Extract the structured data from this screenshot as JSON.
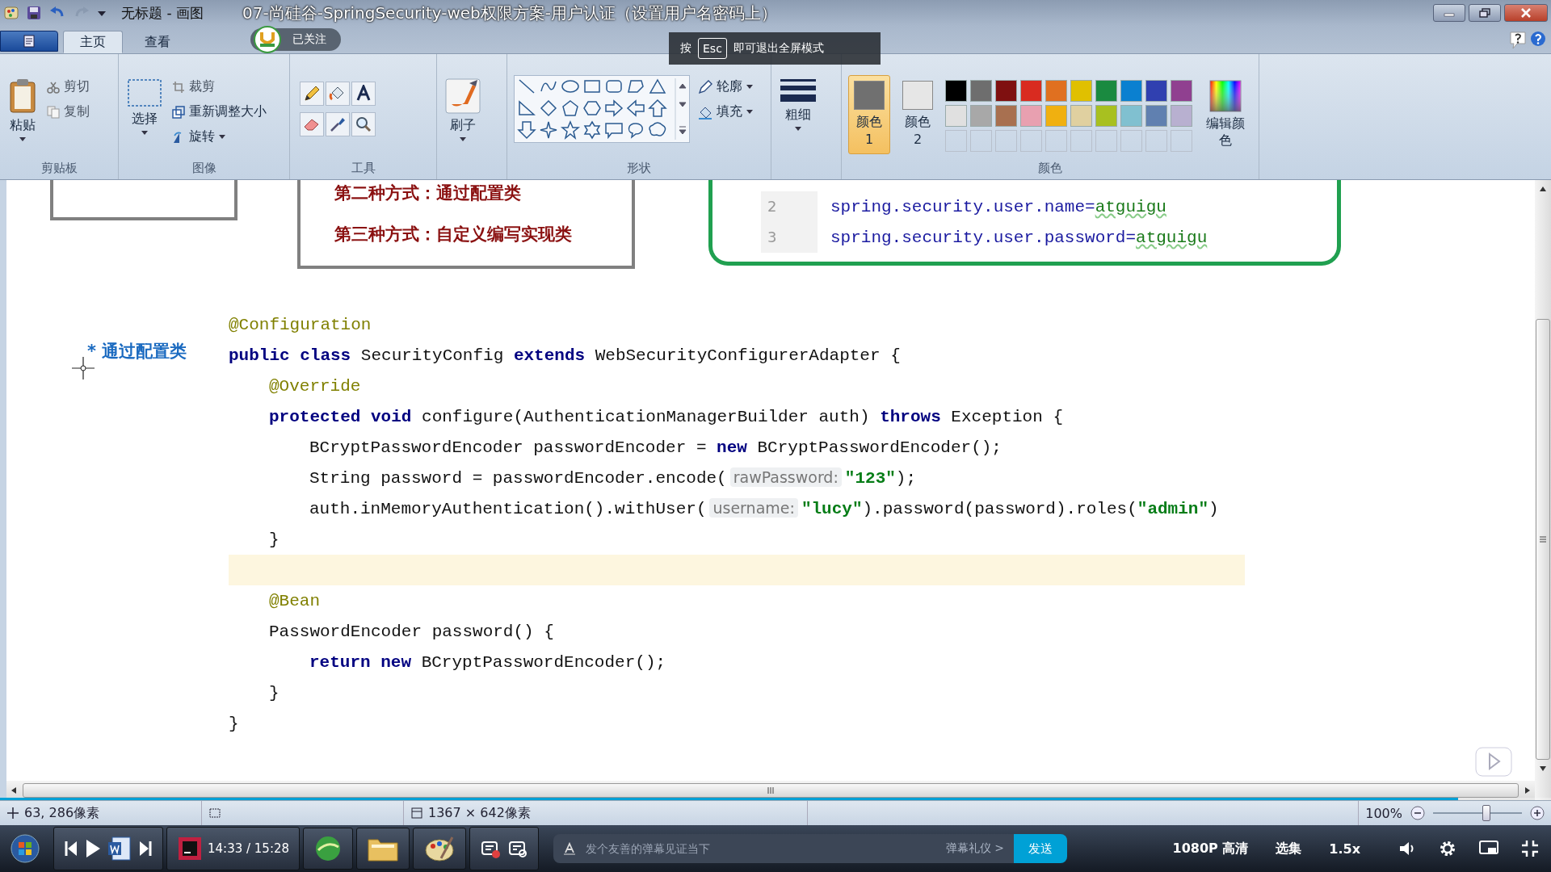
{
  "paint_window": {
    "title": "无标题 - 画图",
    "ribbon_tabs": [
      {
        "label": "主页",
        "selected": true
      },
      {
        "label": "查看",
        "selected": false
      }
    ],
    "clipboard": {
      "paste": "粘贴",
      "cut": "剪切",
      "copy": "复制",
      "group": "剪贴板"
    },
    "image": {
      "select": "选择",
      "crop": "裁剪",
      "resize": "重新调整大小",
      "rotate": "旋转",
      "group": "图像"
    },
    "tools": {
      "group": "工具"
    },
    "brushes": {
      "label": "刷子"
    },
    "shapes": {
      "outline": "轮廓",
      "fill": "填充",
      "group": "形状"
    },
    "size": {
      "label": "粗细"
    },
    "colors": {
      "color1": {
        "label": "颜色 1",
        "selected": true
      },
      "color2": {
        "label": "颜色 2",
        "selected": false
      },
      "palette": [
        {
          "color": "#000000"
        },
        {
          "color": "#6e6e6e"
        },
        {
          "color": "#7f1010"
        },
        {
          "color": "#d92b20"
        },
        {
          "color": "#e07020"
        },
        {
          "color": "#e0c000"
        },
        {
          "color": "#1a8a40"
        },
        {
          "color": "#0a80d0"
        },
        {
          "color": "#3040b0"
        },
        {
          "color": "#904090"
        },
        {
          "color": "#e0e0e0"
        },
        {
          "color": "#a8a8a8"
        },
        {
          "color": "#a87050"
        },
        {
          "color": "#e8a0b0"
        },
        {
          "color": "#f0b010"
        },
        {
          "color": "#e0d0a0"
        },
        {
          "color": "#a8c020"
        },
        {
          "color": "#80c0d0"
        },
        {
          "color": "#6080b0"
        },
        {
          "color": "#b8b0d0"
        }
      ],
      "edit": "编辑颜色",
      "group": "颜色"
    }
  },
  "canvas": {
    "method_lines": [
      "第二种方式：通过配置类",
      "第三种方式：自定义编写实现类"
    ],
    "properties": [
      {
        "number": "2",
        "key": "spring.security.user.name=",
        "value": "atguigu"
      },
      {
        "number": "3",
        "key": "spring.security.user.password=",
        "value": "atguigu"
      }
    ],
    "annotation": "* 通过配置类",
    "code": [
      {
        "highlighted": false,
        "tokens": [
          {
            "kind": "ann",
            "text": "@Configuration"
          }
        ]
      },
      {
        "highlighted": false,
        "tokens": [
          {
            "kind": "kw",
            "text": "public class"
          },
          {
            "kind": "plain",
            "text": " SecurityConfig "
          },
          {
            "kind": "kw",
            "text": "extends"
          },
          {
            "kind": "plain",
            "text": " WebSecurityConfigurerAdapter {"
          }
        ],
        "children": [
          {
            "highlighted": false,
            "tokens": [
              {
                "kind": "ann",
                "text": "@Override"
              }
            ]
          },
          {
            "highlighted": false,
            "tokens": [
              {
                "kind": "kw",
                "text": "protected void"
              },
              {
                "kind": "plain",
                "text": " configure(AuthenticationManagerBuilder auth) "
              },
              {
                "kind": "kw",
                "text": "throws"
              },
              {
                "kind": "plain",
                "text": " Exception {"
              }
            ],
            "children": [
              {
                "highlighted": false,
                "tokens": [
                  {
                    "kind": "plain",
                    "text": "BCryptPasswordEncoder passwordEncoder = "
                  },
                  {
                    "kind": "kw",
                    "text": "new"
                  },
                  {
                    "kind": "plain",
                    "text": " BCryptPasswordEncoder();"
                  }
                ]
              },
              {
                "highlighted": false,
                "tokens": [
                  {
                    "kind": "plain",
                    "text": "String password = passwordEncoder.encode("
                  },
                  {
                    "kind": "hint",
                    "text": "rawPassword:"
                  },
                  {
                    "kind": "str",
                    "text": "\"123\""
                  },
                  {
                    "kind": "plain",
                    "text": ");"
                  }
                ]
              },
              {
                "highlighted": false,
                "tokens": [
                  {
                    "kind": "plain",
                    "text": "auth.inMemoryAuthentication().withUser("
                  },
                  {
                    "kind": "hint",
                    "text": "username:"
                  },
                  {
                    "kind": "str",
                    "text": "\"lucy\""
                  },
                  {
                    "kind": "plain",
                    "text": ").password(password).roles("
                  },
                  {
                    "kind": "str",
                    "text": "\"admin\""
                  },
                  {
                    "kind": "plain",
                    "text": ")"
                  }
                ]
              }
            ]
          },
          {
            "highlighted": false,
            "tokens": [
              {
                "kind": "plain",
                "text": "}"
              }
            ]
          },
          {
            "highlighted": true
          },
          {
            "highlighted": false,
            "tokens": [
              {
                "kind": "ann",
                "text": "@Bean"
              }
            ]
          },
          {
            "highlighted": false,
            "tokens": [
              {
                "kind": "plain",
                "text": "PasswordEncoder password() {"
              }
            ],
            "children": [
              {
                "highlighted": false,
                "tokens": [
                  {
                    "kind": "kw",
                    "text": "return new"
                  },
                  {
                    "kind": "plain",
                    "text": " BCryptPasswordEncoder();"
                  }
                ]
              }
            ]
          },
          {
            "highlighted": false,
            "tokens": [
              {
                "kind": "plain",
                "text": "}"
              }
            ]
          }
        ]
      },
      {
        "highlighted": false,
        "tokens": [
          {
            "kind": "plain",
            "text": "}"
          }
        ]
      }
    ]
  },
  "status_bar": {
    "cursor": "63, 286像素",
    "size": "1367 × 642像素",
    "zoom": "100%",
    "zoom_slider": {
      "level": 0.6
    }
  },
  "video_overlay": {
    "title": "07-尚硅谷-SpringSecurity-web权限方案-用户认证（设置用户名密码上）",
    "follow": "已关注",
    "esc_notice": {
      "before": "按",
      "key": "Esc",
      "after": "即可退出全屏模式"
    },
    "progress": {
      "level": 0.94
    }
  },
  "player_bar": {
    "time": "14:33 / 15:28",
    "danmaku_placeholder": "发个友善的弹幕见证当下",
    "etiquette": "弹幕礼仪 >",
    "send": "发送",
    "quality": "1080P 高清",
    "episodes": "选集",
    "speed": "1.5x"
  }
}
